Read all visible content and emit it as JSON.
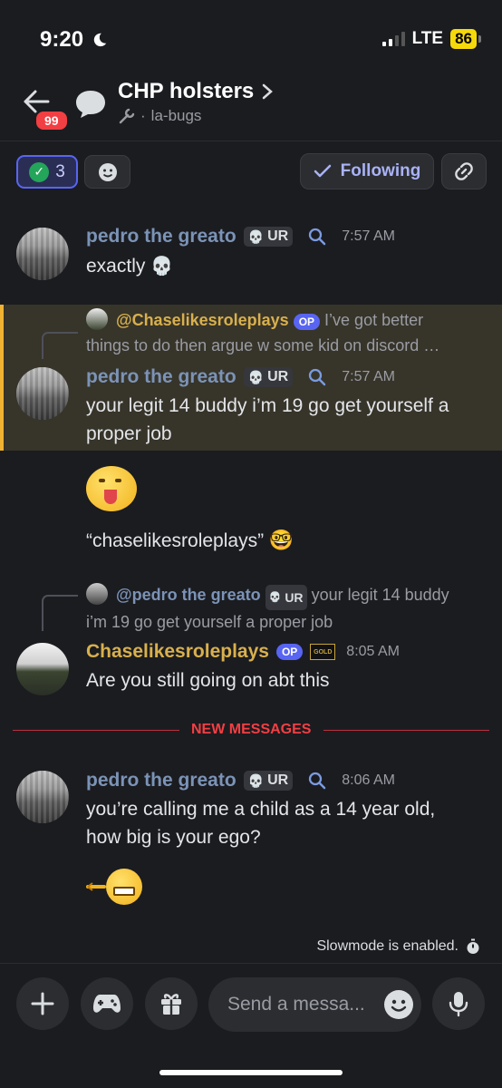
{
  "status_bar": {
    "time": "9:20",
    "network": "LTE",
    "battery": "86"
  },
  "header": {
    "notification_count": "99",
    "title": "CHP holsters",
    "channel": "la-bugs",
    "separator": "·"
  },
  "actions": {
    "check_reaction_count": "3",
    "following_label": "Following"
  },
  "messages": [
    {
      "author": "pedro the greato",
      "tag": "UR",
      "time": "7:57 AM",
      "text": "exactly"
    },
    {
      "reply_to": "@Chaselikesroleplays",
      "reply_badge": "OP",
      "reply_line1": "I’ve got better",
      "reply_line2": "things to do then argue w some kid on discord …",
      "author": "pedro the greato",
      "tag": "UR",
      "time": "7:57 AM",
      "text_line1": "your legit 14 buddy i’m 19 go get yourself a",
      "text_line2": "proper job"
    },
    {
      "quote_text": "“chaselikesroleplays”"
    },
    {
      "reply_to": "@pedro the greato",
      "reply_tag": "UR",
      "reply_line1": "your legit 14 buddy",
      "reply_line2": "i’m 19 go get yourself a proper job",
      "author": "Chaselikesroleplays",
      "badge": "OP",
      "gold_badge": "GOLD",
      "time": "8:05 AM",
      "text": "Are you still going on abt this"
    },
    {
      "author": "pedro the greato",
      "tag": "UR",
      "time": "8:06 AM",
      "text_line1": "you’re calling me a child as a 14 year old,",
      "text_line2": "how big is your ego?"
    }
  ],
  "new_messages_label": "NEW MESSAGES",
  "footer": {
    "slowmode": "Slowmode is enabled.",
    "placeholder": "Send a messa..."
  },
  "colors": {
    "background": "#1b1c20",
    "accent": "#5865f2",
    "pedro_name": "#7b93b6",
    "chase_name": "#d8b04d",
    "new_messages": "#f23f43",
    "highlight_border": "#f0b232"
  },
  "icons": {
    "back": "back-arrow-icon",
    "thread": "thread-bubble-icon",
    "chevron": "chevron-right-icon",
    "wrench": "wrench-icon",
    "add_reaction": "add-reaction-icon",
    "link": "link-icon",
    "search": "search-icon",
    "timer": "timer-icon",
    "plus": "plus-icon",
    "gamepad": "gamepad-icon",
    "gift": "gift-icon",
    "emoji": "emoji-icon",
    "mic": "microphone-icon"
  }
}
